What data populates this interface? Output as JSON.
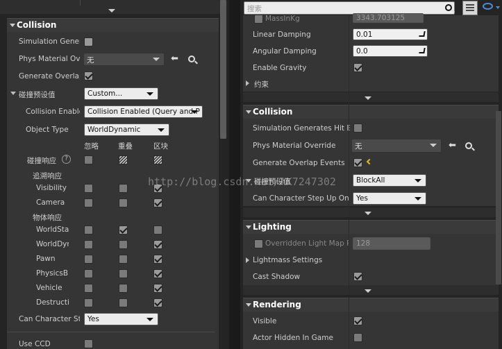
{
  "left": {
    "section_title": "Collision",
    "rows": {
      "simulation": "Simulation Gener",
      "phys_material": "Phys Material Ov",
      "phys_material_value": "无",
      "generate_overlap": "Generate Overlap",
      "preset": "碰撞预设值",
      "preset_value": "Custom...",
      "collision_enabled": "Collision Enable",
      "collision_enabled_value": "Collision Enabled (Query and P",
      "object_type": "Object Type",
      "object_type_value": "WorldDynamic",
      "col_ignore": "忽略",
      "col_overlap": "重叠",
      "col_block": "区块",
      "collision_response": "碰撞响应",
      "trace_response": "追溯响应",
      "visibility": "Visibility",
      "camera": "Camera",
      "object_response": "物体响应",
      "world_static": "WorldStat",
      "world_dynamic": "WorldDyn",
      "pawn": "Pawn",
      "physics_body": "PhysicsB",
      "vehicle": "Vehicle",
      "destructible": "Destructi",
      "can_step": "Can Character Ste",
      "can_step_value": "Yes",
      "use_ccd": "Use CCD"
    }
  },
  "right": {
    "search_placeholder": "搜索",
    "mass_label": "MassInKg",
    "mass_value": "3343.703125",
    "linear_damping": "Linear Damping",
    "linear_damping_value": "0.01",
    "angular_damping": "Angular Damping",
    "angular_damping_value": "0.0",
    "enable_gravity": "Enable Gravity",
    "constraints": "约束",
    "collision_title": "Collision",
    "simulation": "Simulation Generates Hit Ev",
    "phys_material": "Phys Material Override",
    "phys_material_value": "无",
    "generate_overlap": "Generate Overlap Events",
    "preset": "碰撞预设值",
    "preset_value": "BlockAll",
    "can_step": "Can Character Step Up On",
    "can_step_value": "Yes",
    "lighting_title": "Lighting",
    "overridden_lightmap": "Overridden Light Map Re",
    "overridden_lightmap_value": "128",
    "lightmass_settings": "Lightmass Settings",
    "cast_shadow": "Cast Shadow",
    "rendering_title": "Rendering",
    "visible": "Visible",
    "actor_hidden": "Actor Hidden In Game"
  },
  "watermark": "http://blog.csdn.net/AK7247302"
}
